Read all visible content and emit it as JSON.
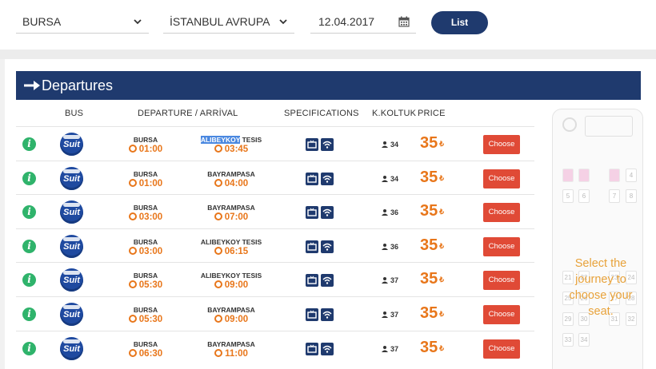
{
  "search": {
    "from": "BURSA",
    "to": "İSTANBUL AVRUPA",
    "date": "12.04.2017",
    "list_label": "List"
  },
  "header": {
    "title": "Departures"
  },
  "columns": {
    "bus": "BUS",
    "departure_arrival": "DEPARTURE / ARRİVAL",
    "specifications": "SPECIFICATIONS",
    "koltuk": "K.KOLTUK",
    "price": "PRICE"
  },
  "logo_text": "Suit",
  "currency": "₺",
  "choose_label": "Choose",
  "rows": [
    {
      "from": "BURSA",
      "to_hl": "ALIBEYKOY",
      "to": " TESIS",
      "dep_time": "01:00",
      "arr_time": "03:45",
      "seats": "34",
      "price": "35"
    },
    {
      "from": "BURSA",
      "to_hl": "",
      "to": "BAYRAMPASA",
      "dep_time": "01:00",
      "arr_time": "04:00",
      "seats": "34",
      "price": "35"
    },
    {
      "from": "BURSA",
      "to_hl": "",
      "to": "BAYRAMPASA",
      "dep_time": "03:00",
      "arr_time": "07:00",
      "seats": "36",
      "price": "35"
    },
    {
      "from": "BURSA",
      "to_hl": "",
      "to": "ALIBEYKOY TESIS",
      "dep_time": "03:00",
      "arr_time": "06:15",
      "seats": "36",
      "price": "35"
    },
    {
      "from": "BURSA",
      "to_hl": "",
      "to": "ALIBEYKOY TESIS",
      "dep_time": "05:30",
      "arr_time": "09:00",
      "seats": "37",
      "price": "35"
    },
    {
      "from": "BURSA",
      "to_hl": "",
      "to": "BAYRAMPASA",
      "dep_time": "05:30",
      "arr_time": "09:00",
      "seats": "37",
      "price": "35"
    },
    {
      "from": "BURSA",
      "to_hl": "",
      "to": "BAYRAMPASA",
      "dep_time": "06:30",
      "arr_time": "11:00",
      "seats": "37",
      "price": "35"
    }
  ],
  "busmap": {
    "message": "Select the journey to choose your seat.",
    "seat_numbers": [
      "4",
      "5",
      "6",
      "7",
      "8",
      "21",
      "22",
      "23",
      "24",
      "25",
      "26",
      "27",
      "28",
      "29",
      "30",
      "31",
      "32",
      "33",
      "34"
    ]
  },
  "colors": {
    "navy": "#1f3a6e",
    "orange": "#e8761a",
    "choose_red": "#e04a36",
    "info_green": "#2fb36b"
  }
}
